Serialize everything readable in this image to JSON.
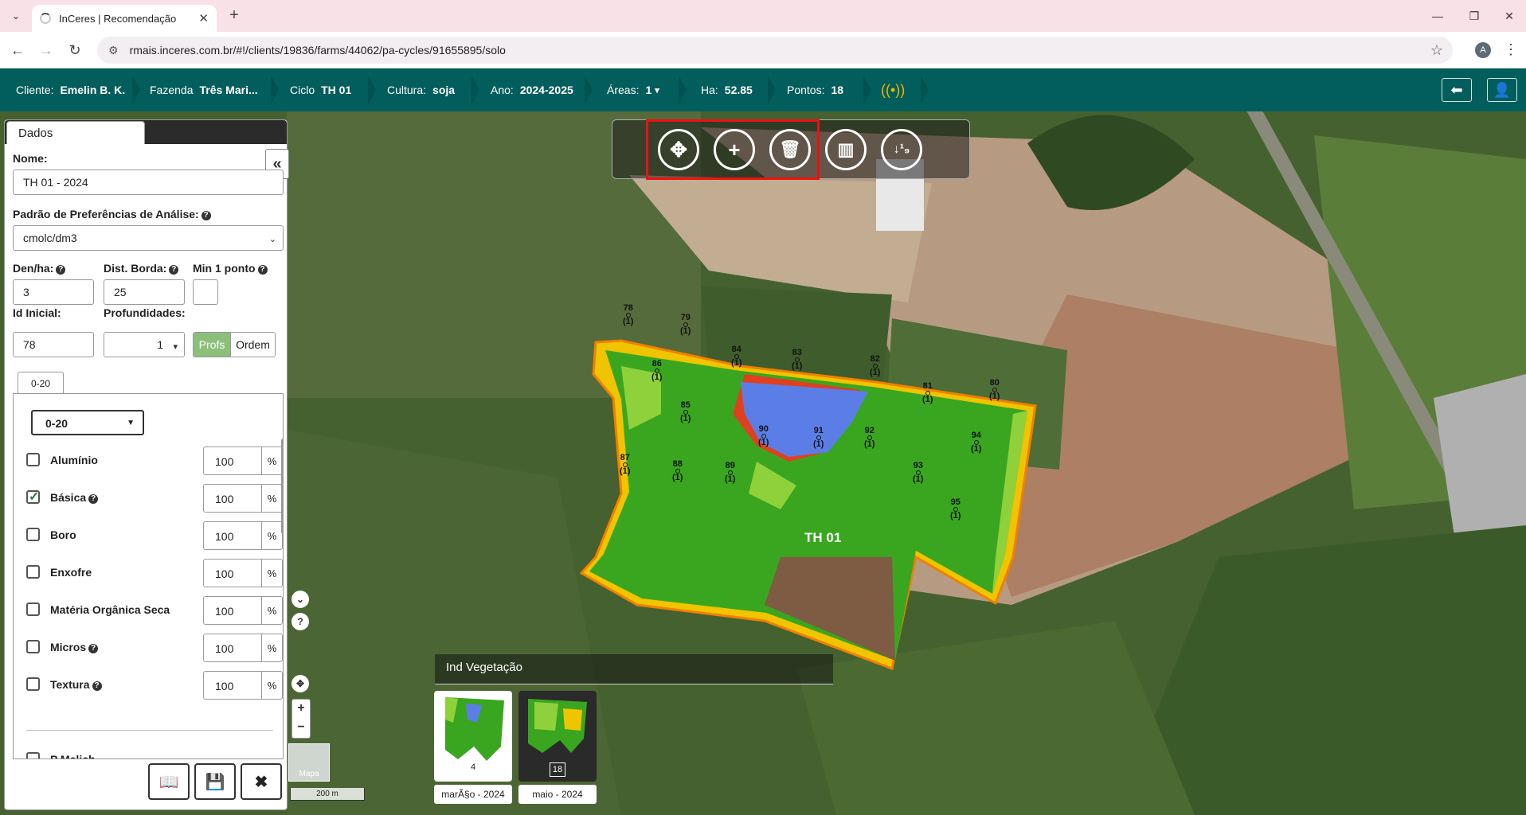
{
  "browser": {
    "tab_title": "InCeres | Recomendação",
    "url": "rmais.inceres.com.br/#!/clients/19836/farms/44062/pa-cycles/91655895/solo",
    "profile_initial": "A"
  },
  "header": {
    "cliente_label": "Cliente:",
    "cliente_value": "Emelin B. K.",
    "fazenda_label": "Fazenda",
    "fazenda_value": "Três Mari...",
    "ciclo_label": "Ciclo",
    "ciclo_value": "TH 01",
    "cultura_label": "Cultura:",
    "cultura_value": "soja",
    "ano_label": "Ano:",
    "ano_value": "2024-2025",
    "areas_label": "Áreas:",
    "areas_value": "1",
    "ha_label": "Ha:",
    "ha_value": "52.85",
    "pontos_label": "Pontos:",
    "pontos_value": "18",
    "colors": {
      "bg": "#015e5c",
      "wifi": "#f0b400"
    }
  },
  "panel": {
    "tab_label": "Dados",
    "nome_label": "Nome:",
    "nome_value": "TH 01 - 2024",
    "padrao_label": "Padrão de Preferências de Análise:",
    "padrao_value": "cmolc/dm3",
    "denha_label": "Den/ha:",
    "denha_value": "3",
    "dist_label": "Dist. Borda:",
    "dist_value": "25",
    "min_label": "Min 1 ponto",
    "idinicial_label": "Id Inicial:",
    "idinicial_value": "78",
    "prof_label": "Profundidades:",
    "prof_value": "1",
    "toggle_profs": "Profs",
    "toggle_ordem": "Ordem",
    "depth_tab": "0-20",
    "depth_select": "0-20",
    "nutrients": [
      {
        "name": "Alumínio",
        "value": "100",
        "unit": "%",
        "checked": false,
        "help": false
      },
      {
        "name": "Básica",
        "value": "100",
        "unit": "%",
        "checked": true,
        "help": true
      },
      {
        "name": "Boro",
        "value": "100",
        "unit": "%",
        "checked": false,
        "help": false
      },
      {
        "name": "Enxofre",
        "value": "100",
        "unit": "%",
        "checked": false,
        "help": false
      },
      {
        "name": "Matéria Orgânica Seca",
        "value": "100",
        "unit": "%",
        "checked": false,
        "help": false
      },
      {
        "name": "Micros",
        "value": "100",
        "unit": "%",
        "checked": false,
        "help": true
      },
      {
        "name": "Textura",
        "value": "100",
        "unit": "%",
        "checked": false,
        "help": true
      }
    ],
    "cut_item": "P Melich"
  },
  "map": {
    "field_label": "TH 01",
    "scale_label": "200 m",
    "maptype_label": "Mapa",
    "veg_title": "Ind Vegetação",
    "thumbs": [
      {
        "caption": "marÃ§o - 2024",
        "badge": "4"
      },
      {
        "caption": "maio - 2024",
        "badge": "18"
      }
    ],
    "points": [
      {
        "id": "78",
        "n": "(1)"
      },
      {
        "id": "79",
        "n": "(1)"
      },
      {
        "id": "86",
        "n": "(1)"
      },
      {
        "id": "84",
        "n": "(1)"
      },
      {
        "id": "83",
        "n": "(1)"
      },
      {
        "id": "82",
        "n": "(1)"
      },
      {
        "id": "81",
        "n": "(1)"
      },
      {
        "id": "80",
        "n": "(1)"
      },
      {
        "id": "85",
        "n": "(1)"
      },
      {
        "id": "90",
        "n": "(1)"
      },
      {
        "id": "91",
        "n": "(1)"
      },
      {
        "id": "92",
        "n": "(1)"
      },
      {
        "id": "94",
        "n": "(1)"
      },
      {
        "id": "87",
        "n": "(1)"
      },
      {
        "id": "88",
        "n": "(1)"
      },
      {
        "id": "89",
        "n": "(1)"
      },
      {
        "id": "93",
        "n": "(1)"
      },
      {
        "id": "95",
        "n": "(1)"
      }
    ]
  }
}
